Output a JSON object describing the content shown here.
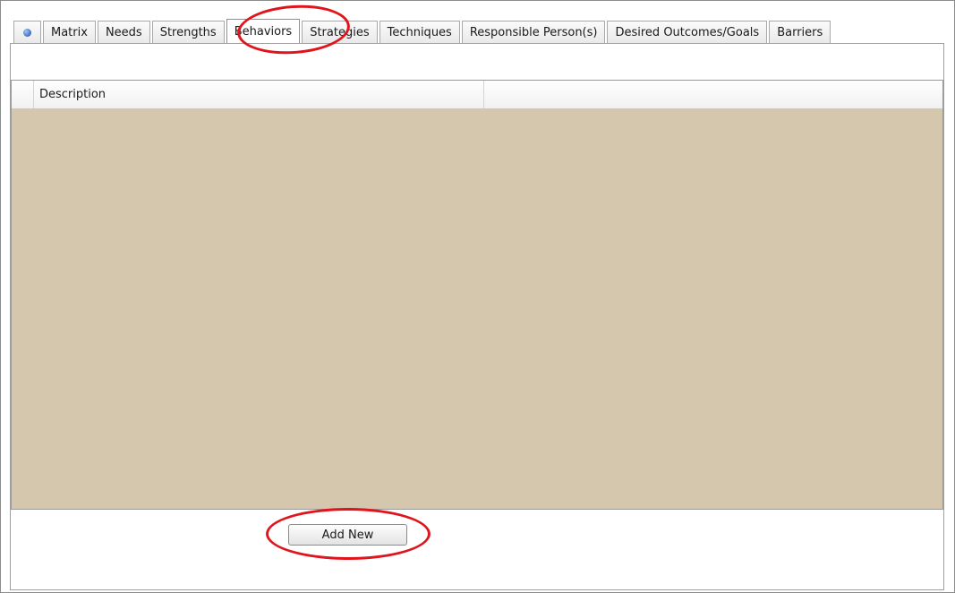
{
  "tabs": [
    {
      "id": "home",
      "label": "",
      "icon": "globe-icon",
      "active": false
    },
    {
      "id": "matrix",
      "label": "Matrix",
      "active": false
    },
    {
      "id": "needs",
      "label": "Needs",
      "active": false
    },
    {
      "id": "strengths",
      "label": "Strengths",
      "active": false
    },
    {
      "id": "behaviors",
      "label": "Behaviors",
      "active": true
    },
    {
      "id": "strategies",
      "label": "Strategies",
      "active": false
    },
    {
      "id": "techniques",
      "label": "Techniques",
      "active": false
    },
    {
      "id": "responsible",
      "label": "Responsible Person(s)",
      "active": false
    },
    {
      "id": "outcomes",
      "label": "Desired Outcomes/Goals",
      "active": false
    },
    {
      "id": "barriers",
      "label": "Barriers",
      "active": false
    }
  ],
  "grid": {
    "columns": [
      "",
      "Description",
      ""
    ],
    "rows": []
  },
  "actions": {
    "add_new_label": "Add New"
  },
  "colors": {
    "grid_background": "#d5c6ae",
    "callout": "#e0141c"
  }
}
